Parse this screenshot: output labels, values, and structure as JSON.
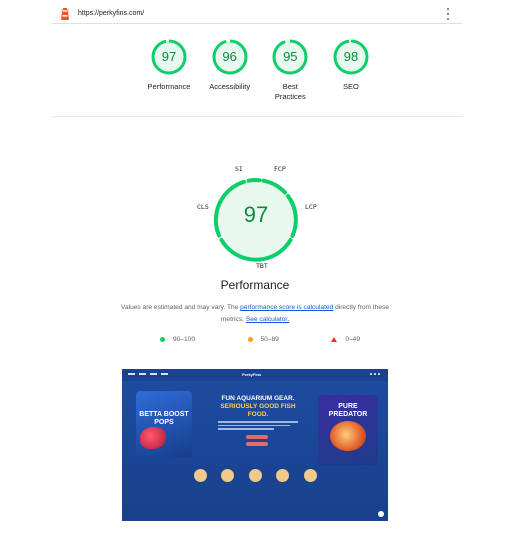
{
  "header": {
    "url": "https://perkyfins.com/",
    "logo_icon": "lighthouse-icon",
    "menu_icon": "kebab-menu-icon"
  },
  "scores": [
    {
      "value": "97",
      "label": "Performance",
      "fraction": 0.97
    },
    {
      "value": "96",
      "label": "Accessibility",
      "fraction": 0.96
    },
    {
      "value": "95",
      "label": "Best Practices",
      "fraction": 0.95
    },
    {
      "value": "98",
      "label": "SEO",
      "fraction": 0.98
    }
  ],
  "performance": {
    "score": "97",
    "fraction": 0.97,
    "title": "Performance",
    "metrics": {
      "si": "SI",
      "fcp": "FCP",
      "cls": "CLS",
      "lcp": "LCP",
      "tbt": "TBT"
    },
    "note_prefix": "Values are estimated and may vary. The ",
    "note_link1": "performance score is calculated",
    "note_mid": " directly from these metrics. ",
    "note_link2": "See calculator."
  },
  "legend": [
    {
      "range": "90–100",
      "color": "#0cce6b",
      "shape": "circle"
    },
    {
      "range": "50–89",
      "color": "#ffa400",
      "shape": "square"
    },
    {
      "range": "0–49",
      "color": "#e5352e",
      "shape": "triangle"
    }
  ],
  "colors": {
    "pass": "#0cce6b",
    "pass_text": "#0c8a3e",
    "pass_fill": "#e8f8ee",
    "link": "#1a56d9"
  },
  "preview": {
    "logo": "PerkyFins",
    "headline_line1": "FUN AQUARIUM GEAR.",
    "headline_line2": "SERIOUSLY GOOD FISH",
    "headline_line3": "FOOD.",
    "left_product": "BETTA BOOST POPS",
    "right_product": "PURE PREDATOR"
  }
}
